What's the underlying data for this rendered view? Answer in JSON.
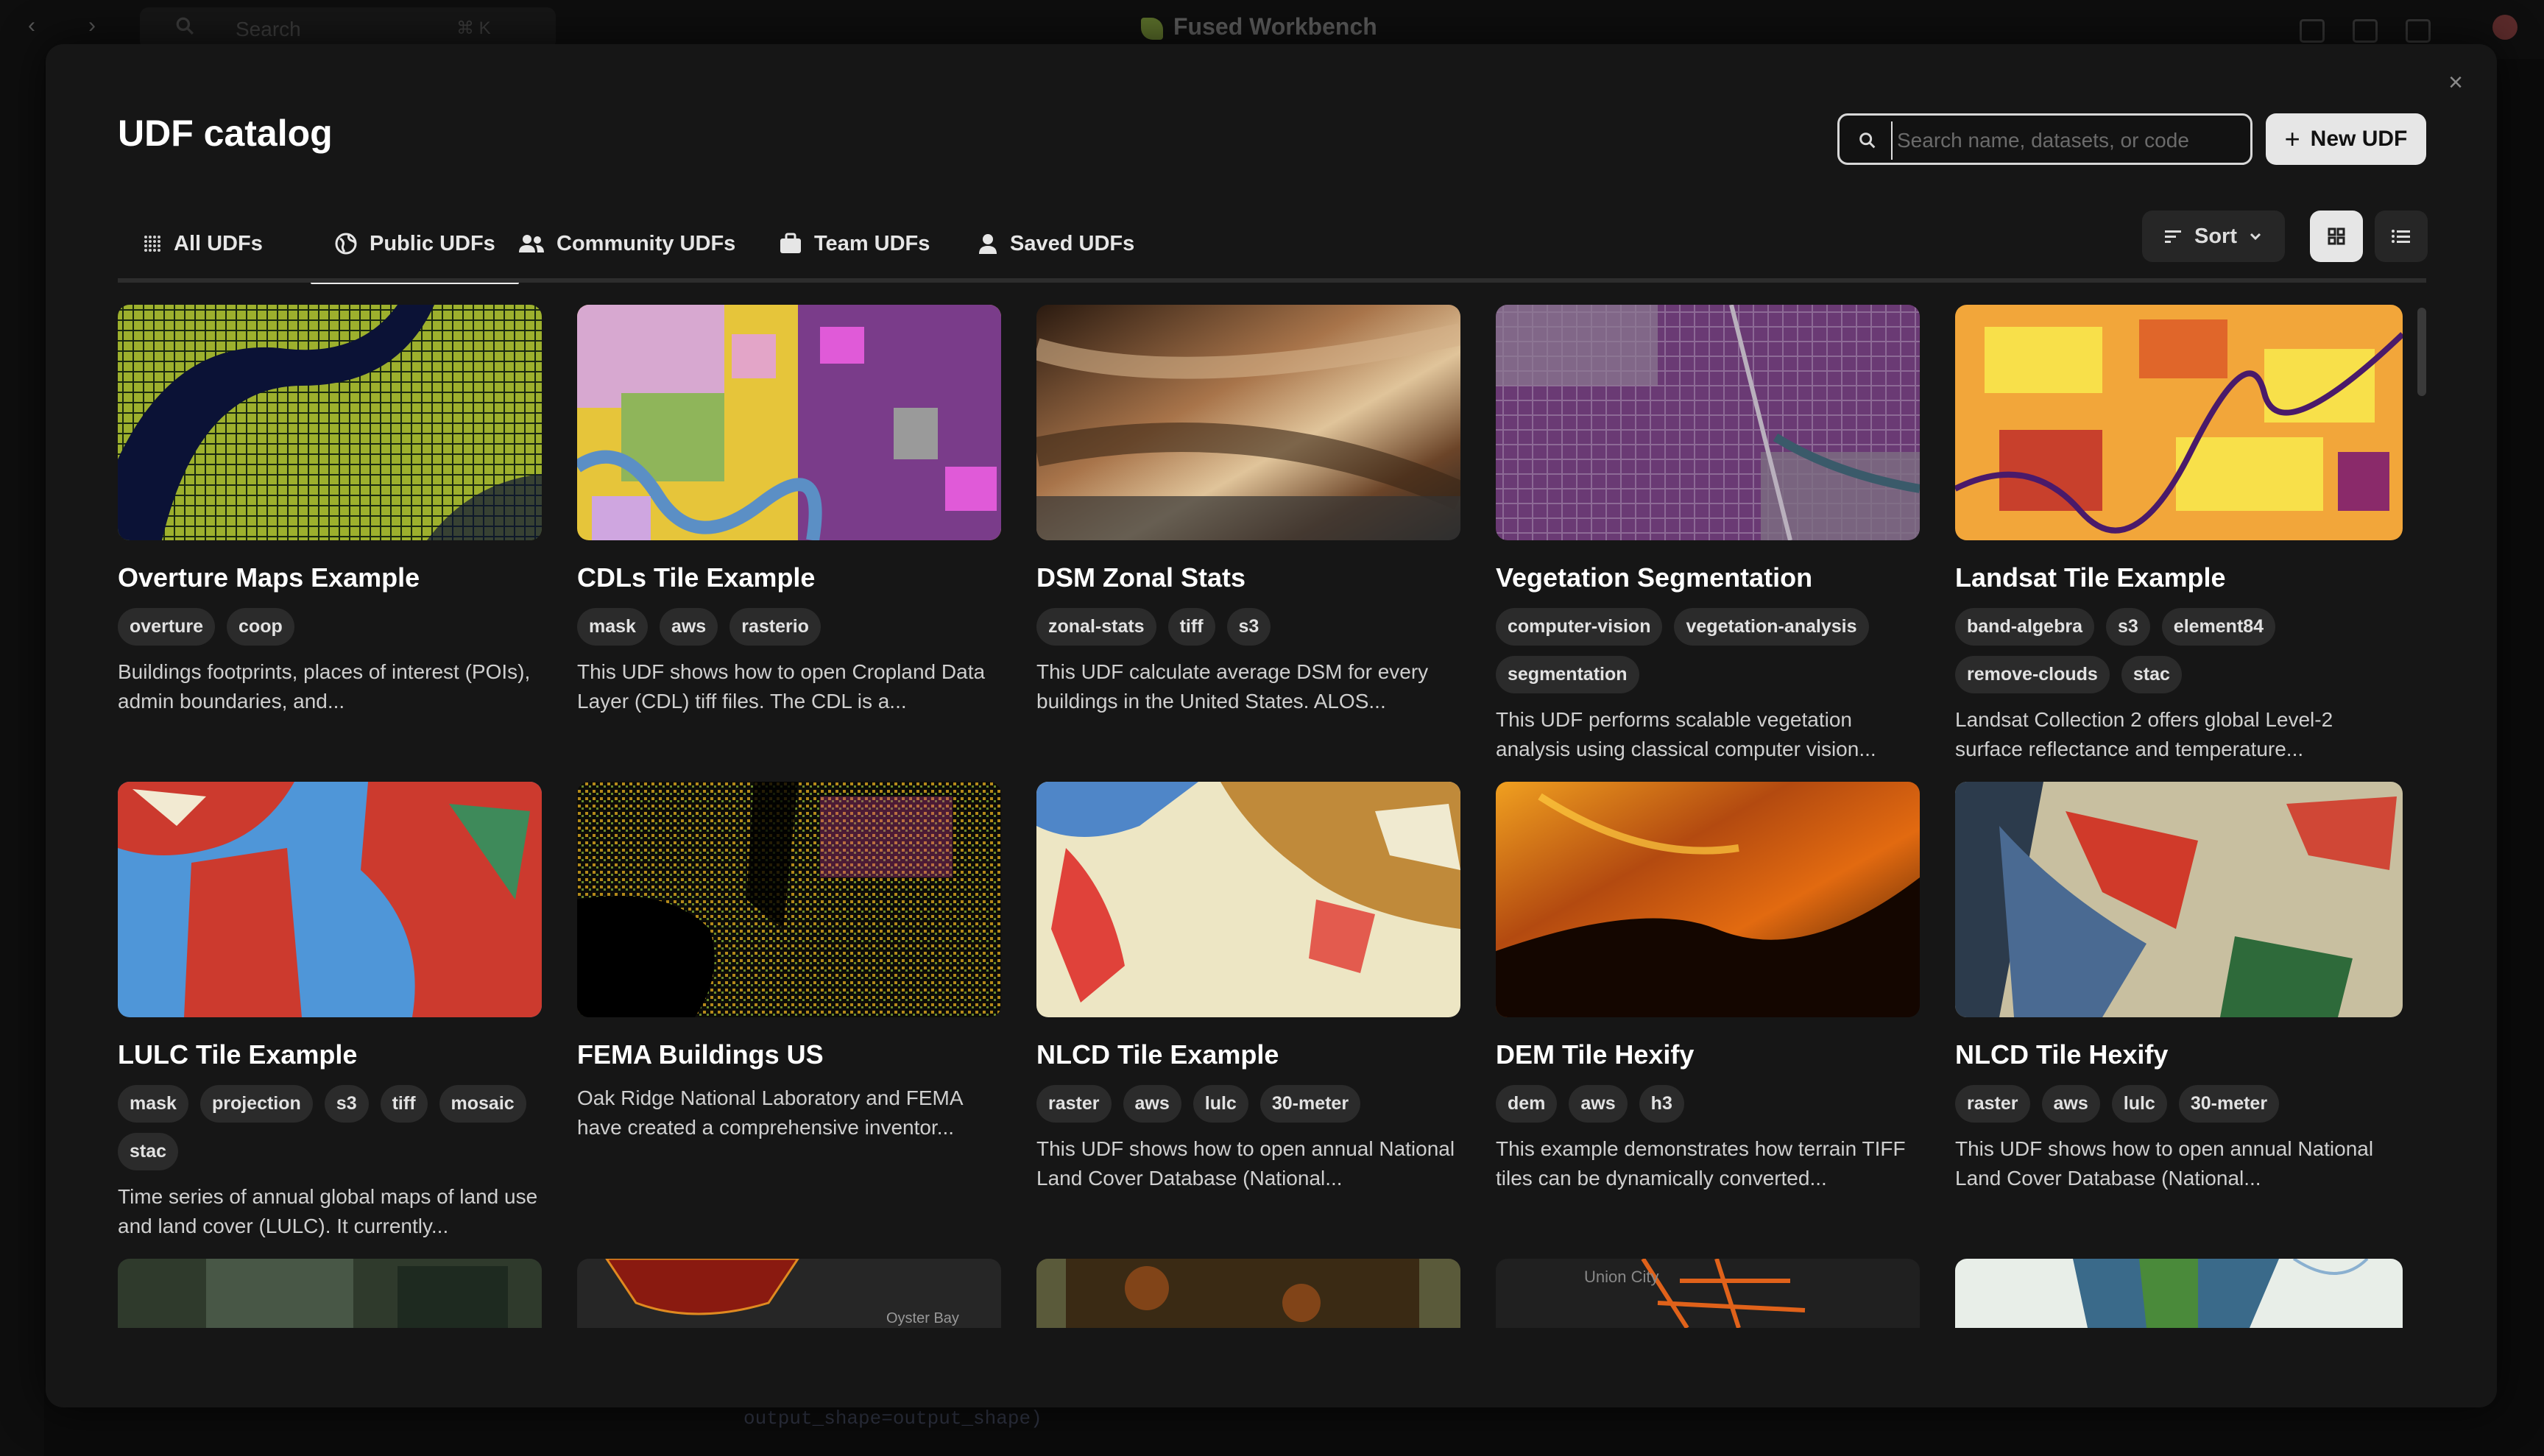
{
  "background": {
    "app_title": "Fused Workbench",
    "search_placeholder": "Search",
    "search_shortcut": "⌘ K",
    "code_snippet": "output_shape=output_shape)"
  },
  "modal": {
    "title": "UDF catalog",
    "search": {
      "placeholder": "Search name, datasets, or code",
      "value": ""
    },
    "new_button": "New UDF",
    "close_label": "×",
    "tabs": [
      {
        "label": "All UDFs",
        "icon": "dots-grid-icon",
        "active": false
      },
      {
        "label": "Public UDFs",
        "icon": "globe-icon",
        "active": true
      },
      {
        "label": "Community UDFs",
        "icon": "users-icon",
        "active": false
      },
      {
        "label": "Team UDFs",
        "icon": "briefcase-icon",
        "active": false
      },
      {
        "label": "Saved UDFs",
        "icon": "user-icon",
        "active": false
      }
    ],
    "sort_label": "Sort",
    "view_mode": "grid"
  },
  "cards": [
    {
      "title": "Overture Maps Example",
      "tags": [
        "overture",
        "coop"
      ],
      "description": "Buildings footprints, places of interest (POIs), admin boundaries, and...",
      "thumb": "overture"
    },
    {
      "title": "CDLs Tile Example",
      "tags": [
        "mask",
        "aws",
        "rasterio"
      ],
      "description": "This UDF shows how to open Cropland Data Layer (CDL) tiff files. The CDL is a...",
      "thumb": "cdl"
    },
    {
      "title": "DSM Zonal Stats",
      "tags": [
        "zonal-stats",
        "tiff",
        "s3"
      ],
      "description": "This UDF calculate average DSM for every buildings in the United States. ALOS...",
      "thumb": "dsm"
    },
    {
      "title": "Vegetation Segmentation",
      "tags": [
        "computer-vision",
        "vegetation-analysis",
        "segmentation"
      ],
      "description": "This UDF performs scalable vegetation analysis using classical computer vision...",
      "thumb": "veg"
    },
    {
      "title": "Landsat Tile Example",
      "tags": [
        "band-algebra",
        "s3",
        "element84",
        "remove-clouds",
        "stac"
      ],
      "description": "Landsat Collection 2 offers global Level-2 surface reflectance and temperature...",
      "thumb": "landsat"
    },
    {
      "title": "LULC Tile Example",
      "tags": [
        "mask",
        "projection",
        "s3",
        "tiff",
        "mosaic",
        "stac"
      ],
      "description": "Time series of annual global maps of land use and land cover (LULC). It currently...",
      "thumb": "lulc"
    },
    {
      "title": "FEMA Buildings US",
      "tags": [],
      "description": "Oak Ridge National Laboratory and FEMA have created a comprehensive inventor...",
      "thumb": "fema"
    },
    {
      "title": "NLCD Tile Example",
      "tags": [
        "raster",
        "aws",
        "lulc",
        "30-meter"
      ],
      "description": "This UDF shows how to open annual National Land Cover Database (National...",
      "thumb": "nlcd"
    },
    {
      "title": "DEM Tile Hexify",
      "tags": [
        "dem",
        "aws",
        "h3"
      ],
      "description": "This example demonstrates how terrain TIFF tiles can be dynamically converted...",
      "thumb": "dem"
    },
    {
      "title": "NLCD Tile Hexify",
      "tags": [
        "raster",
        "aws",
        "lulc",
        "30-meter"
      ],
      "description": "This UDF shows how to open annual National Land Cover Database (National...",
      "thumb": "nlcdhex"
    },
    {
      "title": "",
      "tags": [],
      "description": "",
      "thumb": "sat",
      "map_labels": []
    },
    {
      "title": "",
      "tags": [],
      "description": "",
      "thumb": "fire",
      "map_labels": [
        "Oyster Bay"
      ]
    },
    {
      "title": "",
      "tags": [],
      "description": "",
      "thumb": "forest",
      "map_labels": []
    },
    {
      "title": "",
      "tags": [],
      "description": "",
      "thumb": "city",
      "map_labels": [
        "Union City"
      ]
    },
    {
      "title": "",
      "tags": [],
      "description": "",
      "thumb": "light",
      "map_labels": []
    }
  ],
  "colors": {
    "modal_bg": "#161616",
    "accent_light": "#e6e6e6",
    "tag_bg": "#2b2b2b"
  }
}
